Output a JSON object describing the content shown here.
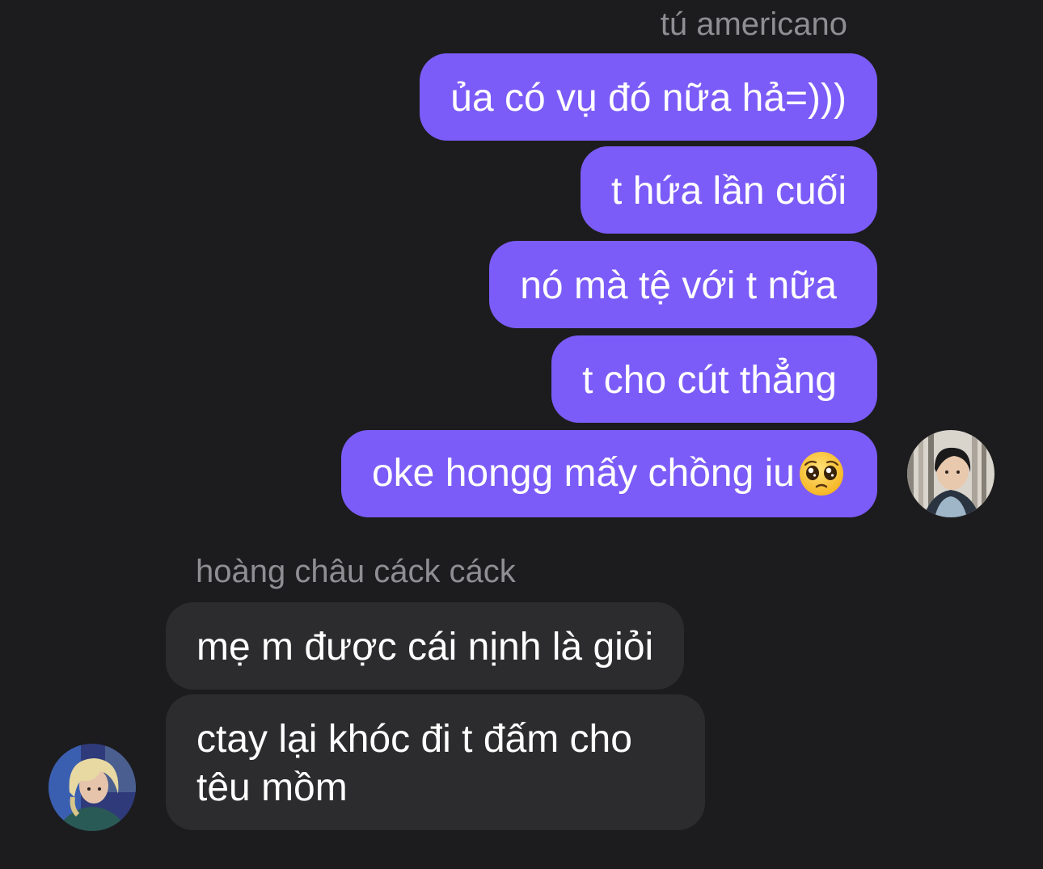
{
  "thread": {
    "outgoing_sender": "tú americano",
    "outgoing_messages": [
      "ủa có vụ đó nữa hả=)))",
      "t hứa lần cuối",
      "nó mà tệ với t nữa",
      "t cho cút thẳng",
      "oke hongg mấy chồng iu"
    ],
    "last_message_emoji": "pleading-face-emoji",
    "incoming_sender": "hoàng châu cáck cáck",
    "incoming_messages": [
      "mẹ m được cái nịnh là giỏi",
      "ctay lại khóc đi t đấm cho têu mồm"
    ]
  },
  "colors": {
    "background": "#1c1c1e",
    "outgoing_bubble": "#7c5cf8",
    "incoming_bubble": "#2c2c2e",
    "sender_name": "#8e8e93",
    "text": "#ffffff"
  }
}
